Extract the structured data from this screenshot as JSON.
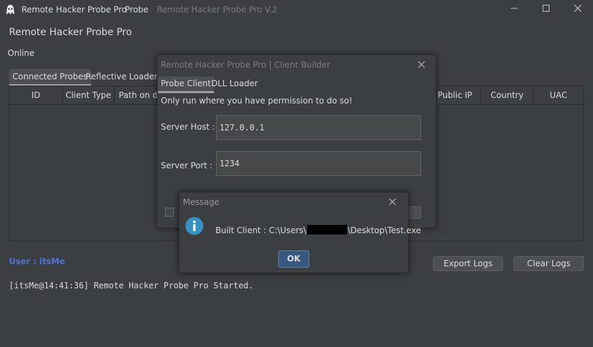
{
  "window": {
    "app_name": "Remote Hacker Probe Pro",
    "menu": [
      "Probe"
    ],
    "version_title": "Remote Hacker Probe Pro V.2"
  },
  "header": {
    "title": "Remote Hacker Probe Pro",
    "status": "Online"
  },
  "tabs": [
    {
      "label": "Connected Probes",
      "selected": true
    },
    {
      "label": "Reflective Loader H"
    }
  ],
  "table": {
    "columns": [
      "ID",
      "Client Type",
      "Path on di",
      "Public IP",
      "Country",
      "UAC"
    ],
    "rows": []
  },
  "footer": {
    "user_label": "User : itsMe",
    "export_logs": "Export Logs",
    "clear_logs": "Clear Logs"
  },
  "logs": [
    "[itsMe@14:41:36] Remote Hacker Probe Pro Started."
  ],
  "builder": {
    "title": "Remote Hacker Probe Pro | Client Builder",
    "tabs": [
      {
        "label": "Probe Client",
        "selected": true
      },
      {
        "label": "DLL Loader"
      }
    ],
    "warning": "Only run where you have permission to do so!",
    "host_label": "Server Host :",
    "host_value": "127.0.0.1",
    "port_label": "Server Port :",
    "port_value": "1234"
  },
  "message": {
    "title": "Message",
    "text_prefix": "Built Client : C:\\Users\\",
    "text_suffix": "\\Desktop\\Test.exe",
    "ok": "OK"
  },
  "icons": [
    "app-logo-icon",
    "minimize-icon",
    "maximize-icon",
    "close-icon",
    "info-icon"
  ],
  "colors": {
    "background": "#3c3f41",
    "user_label": "#4f74d6",
    "ok_button": "#365880",
    "info_icon": "#3592c4"
  }
}
